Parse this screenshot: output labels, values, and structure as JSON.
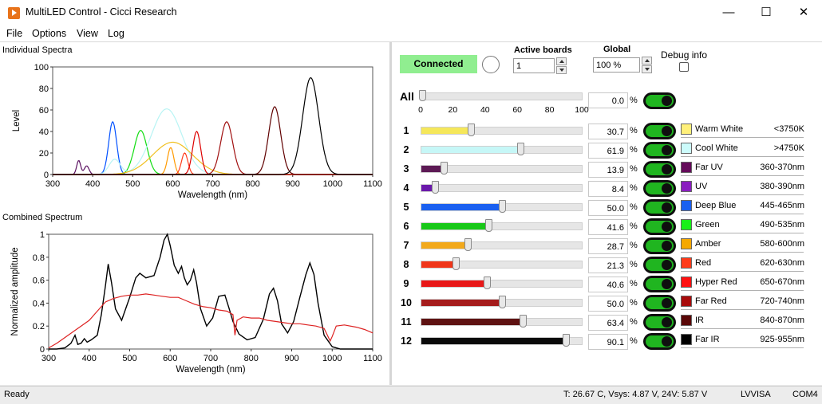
{
  "window": {
    "title": "MultiLED Control - Cicci Research",
    "min_glyph": "—",
    "max_glyph": "☐",
    "close_glyph": "✕"
  },
  "menu": [
    "File",
    "Options",
    "View",
    "Log"
  ],
  "plots": {
    "individual_title": "Individual Spectra",
    "combined_title": "Combined Spectrum"
  },
  "chart_data": [
    {
      "type": "line",
      "title": "Individual Spectra",
      "xlabel": "Wavelength (nm)",
      "ylabel": "Level",
      "xlim": [
        300,
        1100
      ],
      "ylim": [
        0,
        100
      ],
      "xticks": [
        "300",
        "400",
        "500",
        "600",
        "700",
        "800",
        "900",
        "1000",
        "1100"
      ],
      "yticks": [
        "0",
        "20",
        "40",
        "60",
        "80",
        "100"
      ],
      "series": [
        {
          "color": "#5a1060",
          "peaks": [
            [
              365,
              13,
              5
            ],
            [
              385,
              8,
              6
            ]
          ]
        },
        {
          "color": "#0050ff",
          "peaks": [
            [
              450,
              49,
              10
            ]
          ]
        },
        {
          "color": "#11dd11",
          "peaks": [
            [
              520,
              41,
              16
            ]
          ]
        },
        {
          "color": "#b8f4f4",
          "peaks": [
            [
              455,
              14,
              14
            ],
            [
              585,
              61,
              38
            ]
          ]
        },
        {
          "color": "#f0c020",
          "peaks": [
            [
              600,
              30,
              50
            ]
          ]
        },
        {
          "color": "#ff9a00",
          "peaks": [
            [
              595,
              25,
              8
            ]
          ]
        },
        {
          "color": "#ff3b1a",
          "peaks": [
            [
              630,
              20,
              8
            ]
          ]
        },
        {
          "color": "#dd0000",
          "peaks": [
            [
              660,
              40,
              10
            ]
          ]
        },
        {
          "color": "#a01010",
          "peaks": [
            [
              735,
              49,
              15
            ]
          ]
        },
        {
          "color": "#600000",
          "peaks": [
            [
              855,
              63,
              15
            ]
          ]
        },
        {
          "color": "#000000",
          "peaks": [
            [
              945,
              90,
              20
            ]
          ]
        }
      ]
    },
    {
      "type": "line",
      "title": "Combined Spectrum",
      "xlabel": "Wavelength (nm)",
      "ylabel": "Normalized amplitude",
      "xlim": [
        300,
        1100
      ],
      "ylim": [
        0,
        1
      ],
      "xticks": [
        "300",
        "400",
        "500",
        "600",
        "700",
        "800",
        "900",
        "1000",
        "1100"
      ],
      "yticks": [
        "0",
        "0.2",
        "0.4",
        "0.6",
        "0.8",
        "1"
      ],
      "series": [
        {
          "color": "#000000",
          "x": [
            300,
            320,
            340,
            355,
            365,
            372,
            380,
            388,
            395,
            405,
            420,
            430,
            440,
            447,
            455,
            465,
            480,
            500,
            515,
            525,
            540,
            560,
            575,
            585,
            593,
            600,
            610,
            620,
            628,
            635,
            642,
            650,
            658,
            665,
            675,
            690,
            705,
            720,
            735,
            745,
            755,
            770,
            790,
            810,
            830,
            845,
            855,
            865,
            875,
            890,
            905,
            920,
            935,
            945,
            955,
            965,
            980,
            1000,
            1020,
            1050,
            1100
          ],
          "y": [
            0.0,
            0.0,
            0.01,
            0.05,
            0.12,
            0.04,
            0.05,
            0.09,
            0.06,
            0.08,
            0.12,
            0.3,
            0.55,
            0.74,
            0.58,
            0.35,
            0.25,
            0.45,
            0.62,
            0.66,
            0.62,
            0.64,
            0.8,
            0.95,
            1.0,
            0.9,
            0.73,
            0.66,
            0.72,
            0.62,
            0.56,
            0.6,
            0.69,
            0.58,
            0.35,
            0.2,
            0.27,
            0.46,
            0.47,
            0.36,
            0.24,
            0.13,
            0.08,
            0.1,
            0.26,
            0.48,
            0.53,
            0.42,
            0.22,
            0.14,
            0.24,
            0.45,
            0.65,
            0.75,
            0.65,
            0.4,
            0.12,
            0.02,
            0.0,
            0.0,
            0.0
          ]
        },
        {
          "color": "#dd2222",
          "x": [
            300,
            320,
            340,
            360,
            380,
            400,
            420,
            440,
            460,
            480,
            500,
            520,
            540,
            560,
            580,
            600,
            620,
            640,
            660,
            680,
            700,
            720,
            740,
            755,
            760,
            765,
            780,
            800,
            820,
            840,
            860,
            880,
            900,
            920,
            940,
            960,
            980,
            995,
            1000,
            1010,
            1030,
            1060,
            1080,
            1100
          ],
          "y": [
            0.01,
            0.05,
            0.1,
            0.15,
            0.2,
            0.25,
            0.33,
            0.41,
            0.44,
            0.46,
            0.47,
            0.47,
            0.48,
            0.47,
            0.46,
            0.45,
            0.45,
            0.42,
            0.39,
            0.37,
            0.36,
            0.34,
            0.33,
            0.3,
            0.12,
            0.25,
            0.28,
            0.27,
            0.27,
            0.25,
            0.24,
            0.23,
            0.22,
            0.22,
            0.21,
            0.2,
            0.18,
            0.07,
            0.11,
            0.2,
            0.21,
            0.19,
            0.17,
            0.14
          ]
        }
      ]
    }
  ],
  "controls": {
    "connected_label": "Connected",
    "active_boards_label": "Active boards",
    "active_boards_value": "1",
    "global_label": "Global",
    "global_value": "100 %",
    "debug_label": "Debug info",
    "all_label": "All",
    "all_value": "0.0",
    "all_pct": 0.0,
    "all_ticks": [
      "0",
      "20",
      "40",
      "60",
      "80",
      "100"
    ],
    "pct_sign": "%"
  },
  "leds": [
    {
      "num": "1",
      "value": "30.7",
      "pct": 30.7,
      "color": "#f5e75a",
      "swatch": "#fff07a",
      "name": "Warm White",
      "range": "<3750K"
    },
    {
      "num": "2",
      "value": "61.9",
      "pct": 61.9,
      "color": "#c6f7f7",
      "swatch": "#ccfbfb",
      "name": "Cool White",
      "range": ">4750K"
    },
    {
      "num": "3",
      "value": "13.9",
      "pct": 13.9,
      "color": "#5d1a55",
      "swatch": "#650a5a",
      "name": "Far UV",
      "range": "360-370nm"
    },
    {
      "num": "4",
      "value": "8.4",
      "pct": 8.4,
      "color": "#6a18aa",
      "swatch": "#8a1ec0",
      "name": "UV",
      "range": "380-390nm"
    },
    {
      "num": "5",
      "value": "50.0",
      "pct": 50.0,
      "color": "#1a60f0",
      "swatch": "#1a60f0",
      "name": "Deep Blue",
      "range": "445-465nm"
    },
    {
      "num": "6",
      "value": "41.6",
      "pct": 41.6,
      "color": "#18c818",
      "swatch": "#19f019",
      "name": "Green",
      "range": "490-535nm"
    },
    {
      "num": "7",
      "value": "28.7",
      "pct": 28.7,
      "color": "#f2a91c",
      "swatch": "#f5a800",
      "name": "Amber",
      "range": "580-600nm"
    },
    {
      "num": "8",
      "value": "21.3",
      "pct": 21.3,
      "color": "#f0361a",
      "swatch": "#ff3b1a",
      "name": "Red",
      "range": "620-630nm"
    },
    {
      "num": "9",
      "value": "40.6",
      "pct": 40.6,
      "color": "#e81818",
      "swatch": "#ff1010",
      "name": "Hyper Red",
      "range": "650-670nm"
    },
    {
      "num": "10",
      "value": "50.0",
      "pct": 50.0,
      "color": "#a51c1c",
      "swatch": "#a80b0b",
      "name": "Far Red",
      "range": "720-740nm"
    },
    {
      "num": "11",
      "value": "63.4",
      "pct": 63.4,
      "color": "#5e1212",
      "swatch": "#5a0808",
      "name": "IR",
      "range": "840-870nm"
    },
    {
      "num": "12",
      "value": "90.1",
      "pct": 90.1,
      "color": "#0a0a0a",
      "swatch": "#000000",
      "name": "Far IR",
      "range": "925-955nm"
    }
  ],
  "status": {
    "ready": "Ready",
    "telemetry": "T: 26.67 C, Vsys: 4.87 V, 24V: 5.87 V",
    "driver": "LVVISA",
    "port": "COM4"
  }
}
